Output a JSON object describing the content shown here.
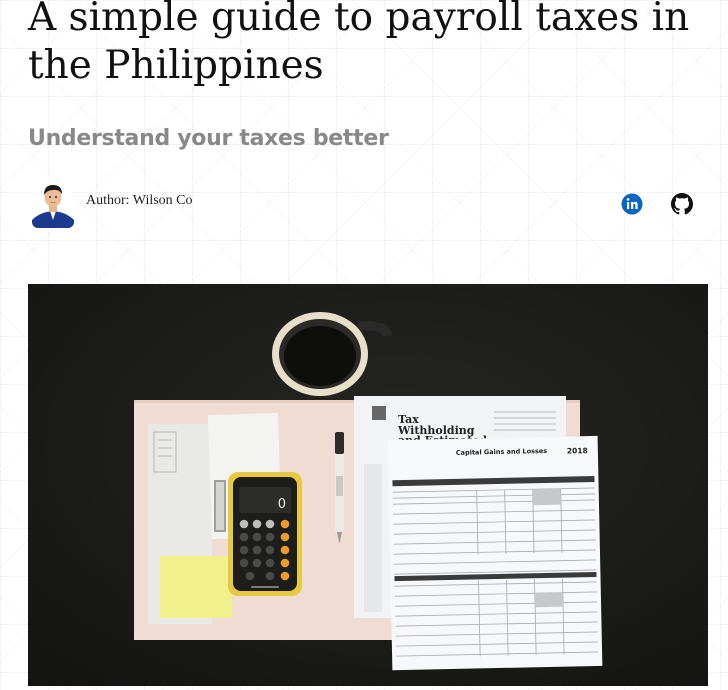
{
  "article": {
    "title": "A simple guide to payroll taxes in the Philippines",
    "subtitle": "Understand your taxes better"
  },
  "author": {
    "label": "Author: Wilson Co"
  },
  "social": [
    {
      "name": "LinkedIn",
      "icon": "linkedin-icon",
      "color": "#0a66c2"
    },
    {
      "name": "GitHub",
      "icon": "github-icon",
      "color": "#111111"
    }
  ],
  "hero_image": {
    "form_title_line1": "Tax",
    "form_title_line2": "Withholding",
    "form_title_line3": "and Estimated",
    "schedule_heading": "Capital Gains and Losses",
    "year": "2018",
    "calculator_display": "0"
  },
  "colors": {
    "title": "#111111",
    "subtitle": "#888888",
    "hero_background": "#1c1c1a"
  }
}
